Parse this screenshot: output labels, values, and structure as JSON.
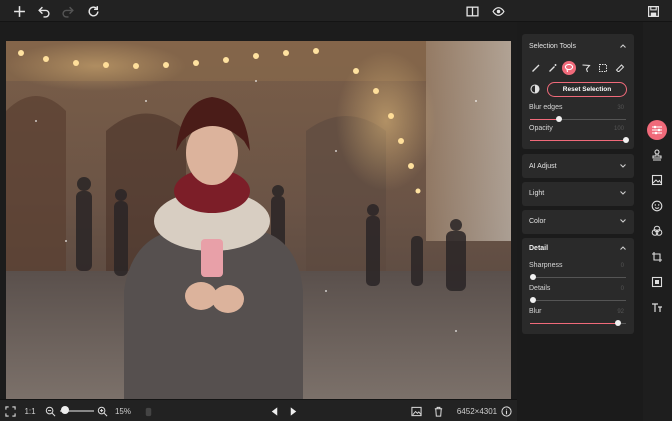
{
  "colors": {
    "accent": "#f06a7a",
    "bg": "#1e1e1e",
    "panel": "#2a2a2a"
  },
  "toolbar": {
    "left": [
      "plus-icon",
      "undo-icon",
      "redo-icon",
      "reset-icon"
    ],
    "center": [
      "compare-icon",
      "eye-icon"
    ],
    "right": [
      "save-icon"
    ]
  },
  "bottombar": {
    "ratio_label": "1:1",
    "zoom_level": "15%",
    "image_size": "6452×4301",
    "zoom_fraction": 0.1
  },
  "panel": {
    "selection_tools": {
      "title": "Selection Tools",
      "tools": [
        "brush-icon",
        "magic-wand-icon",
        "lasso-icon",
        "polygon-lasso-icon",
        "rect-select-icon",
        "eraser-icon"
      ],
      "active_tool": 2,
      "reset_label": "Reset Selection",
      "sliders": [
        {
          "label": "Blur edges",
          "value": "30",
          "fraction": 0.3
        },
        {
          "label": "Opacity",
          "value": "100",
          "fraction": 1.0
        }
      ]
    },
    "sections": [
      {
        "title": "AI Adjust"
      },
      {
        "title": "Light"
      },
      {
        "title": "Color"
      }
    ],
    "detail": {
      "title": "Detail",
      "sliders": [
        {
          "label": "Sharpness",
          "value": "0",
          "fraction": 0.0
        },
        {
          "label": "Details",
          "value": "0",
          "fraction": 0.0
        },
        {
          "label": "Blur",
          "value": "92",
          "fraction": 0.92
        }
      ]
    }
  },
  "rail": [
    "adjust-icon",
    "stamp-icon",
    "image-layers-icon",
    "face-icon",
    "color-circles-icon",
    "crop-icon",
    "frame-icon",
    "text-icon"
  ],
  "rail_active": 0
}
